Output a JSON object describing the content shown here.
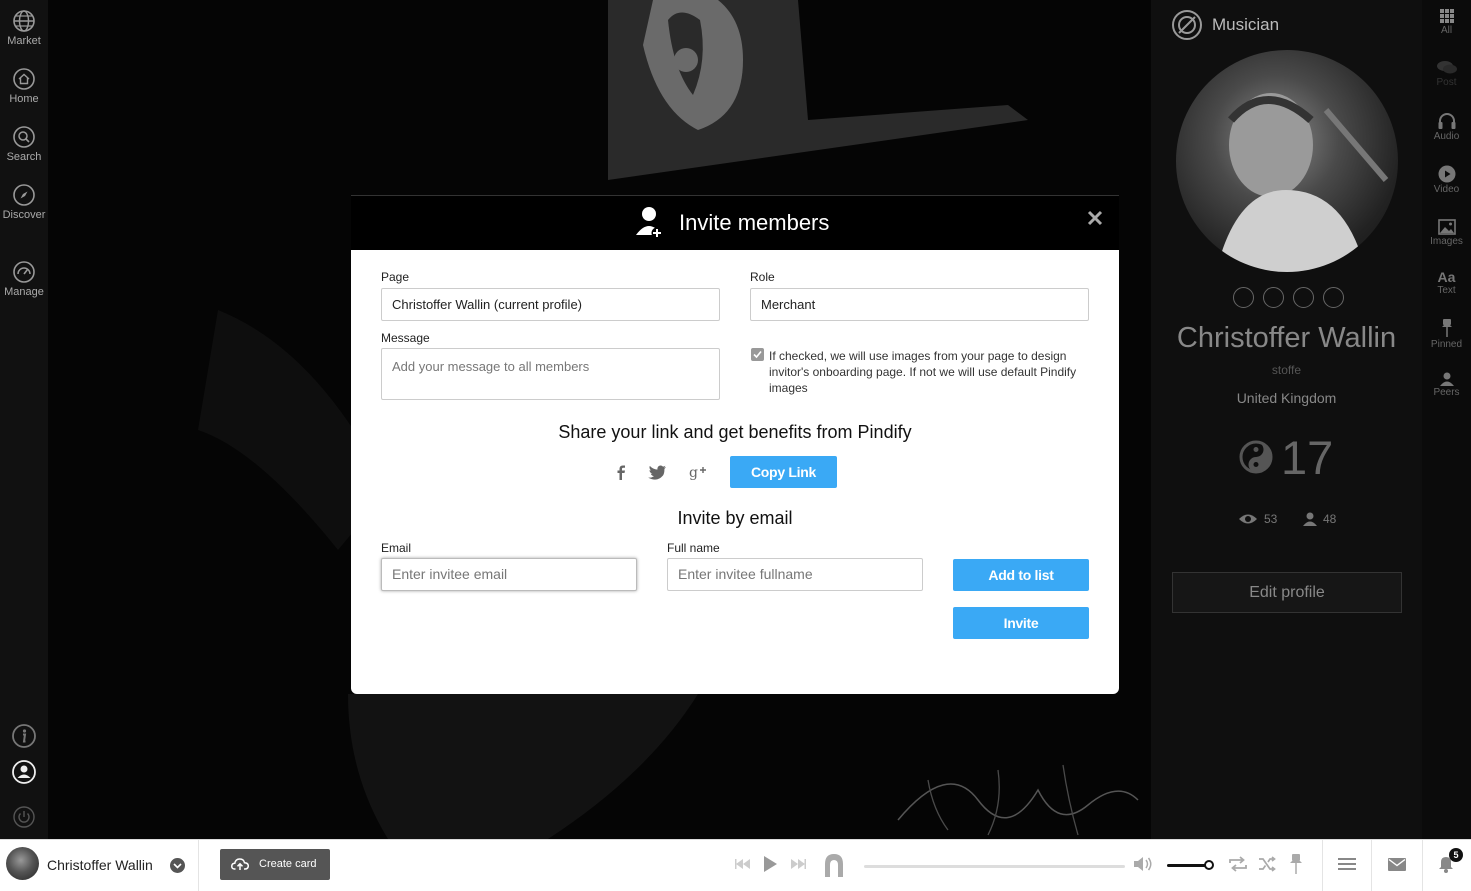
{
  "left_nav": {
    "items": [
      {
        "label": "Market"
      },
      {
        "label": "Home"
      },
      {
        "label": "Search"
      },
      {
        "label": "Discover"
      },
      {
        "label": "Manage"
      }
    ]
  },
  "modal": {
    "title": "Invite members",
    "page_label": "Page",
    "page_value": "Christoffer Wallin (current profile)",
    "role_label": "Role",
    "role_value": "Merchant",
    "message_label": "Message",
    "message_placeholder": "Add your message to all members",
    "checkbox_checked": true,
    "checkbox_text": "If checked, we will use images from your page to design invitor's onboarding page. If not we will use default Pindify images",
    "share_title": "Share your link and get benefits from Pindify",
    "social_icons": [
      "facebook-icon",
      "twitter-icon",
      "google-plus-icon"
    ],
    "copy_link_label": "Copy Link",
    "invite_by_email_title": "Invite by email",
    "email_label": "Email",
    "email_placeholder": "Enter invitee email",
    "fullname_label": "Full name",
    "fullname_placeholder": "Enter invitee fullname",
    "add_to_list_label": "Add to list",
    "invite_label": "Invite"
  },
  "profile": {
    "role_title": "Musician",
    "name": "Christoffer Wallin",
    "username": "stoffe",
    "country": "United Kingdom",
    "score": "17",
    "views": "53",
    "followers": "48",
    "edit_label": "Edit profile"
  },
  "right_rail": {
    "items": [
      {
        "label": "All"
      },
      {
        "label": "Post"
      },
      {
        "label": "Audio"
      },
      {
        "label": "Video"
      },
      {
        "label": "Images"
      },
      {
        "label": "Text"
      },
      {
        "label": "Pinned"
      },
      {
        "label": "Peers"
      }
    ]
  },
  "bottom_bar": {
    "user_name": "Christoffer Wallin",
    "create_card_label": "Create card",
    "notifications_count": "5"
  },
  "colors": {
    "accent_blue": "#3aa9f5",
    "background": "#000000",
    "modal_header": "#000000"
  }
}
